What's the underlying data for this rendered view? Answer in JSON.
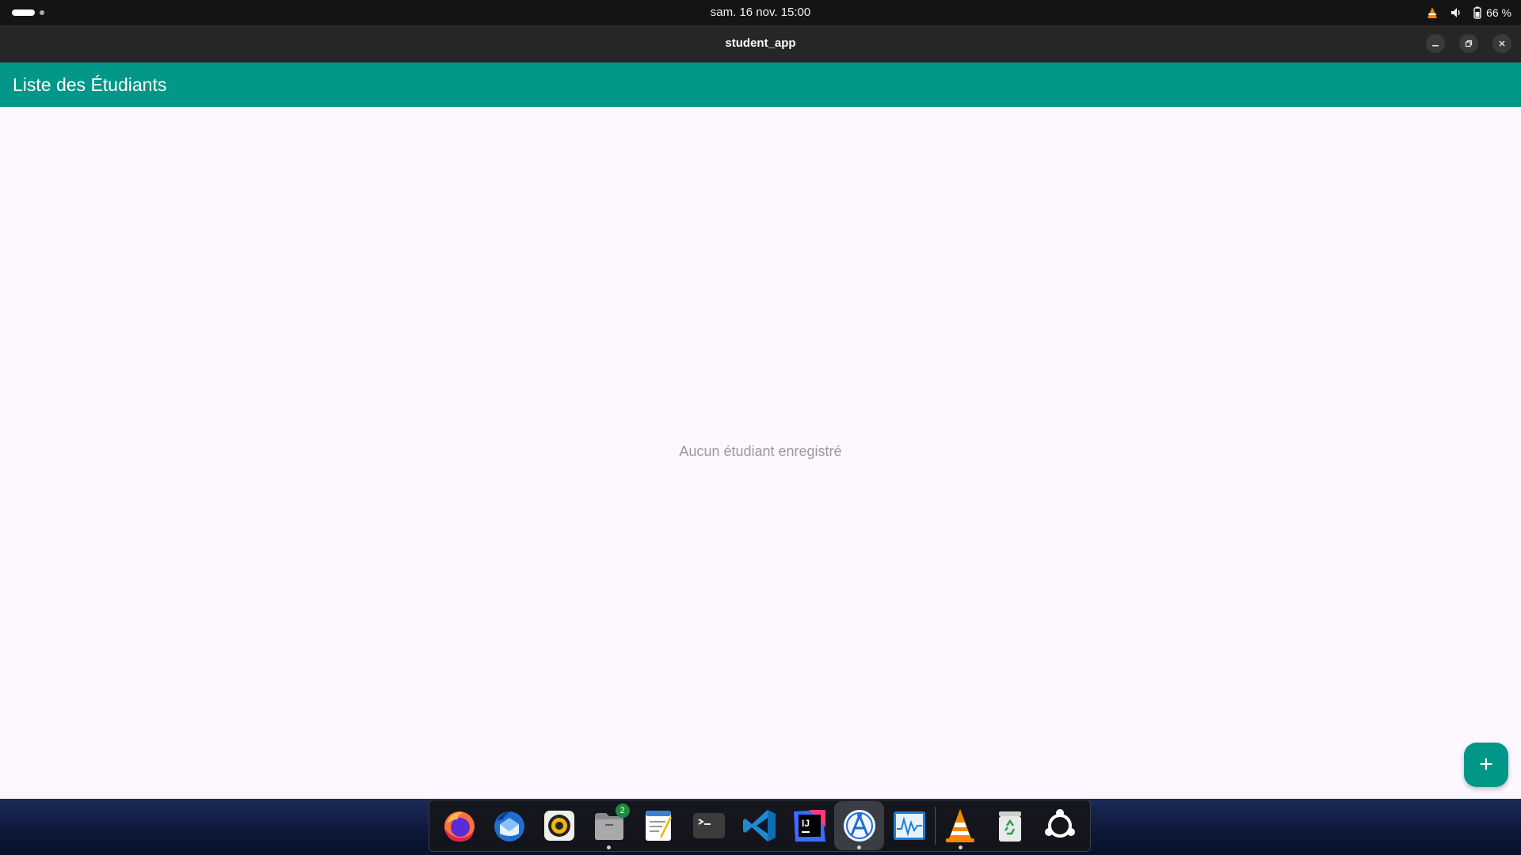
{
  "topbar": {
    "datetime": "sam. 16 nov.  15:00",
    "battery": "66 %"
  },
  "window": {
    "title": "student_app"
  },
  "app": {
    "title": "Liste des Étudiants",
    "empty_message": "Aucun étudiant enregistré",
    "fab_label": "+",
    "primary_color": "#009688",
    "background_color": "#fdf7ff"
  },
  "dock": {
    "items": [
      {
        "name": "firefox-icon"
      },
      {
        "name": "thunderbird-icon"
      },
      {
        "name": "rhythmbox-icon"
      },
      {
        "name": "files-icon",
        "badge": "2"
      },
      {
        "name": "text-editor-icon"
      },
      {
        "name": "terminal-icon"
      },
      {
        "name": "vscode-icon"
      },
      {
        "name": "intellij-icon"
      },
      {
        "name": "android-studio-icon"
      },
      {
        "name": "system-monitor-icon"
      },
      {
        "name": "vlc-icon"
      },
      {
        "name": "trash-icon"
      },
      {
        "name": "show-apps-icon"
      }
    ]
  }
}
